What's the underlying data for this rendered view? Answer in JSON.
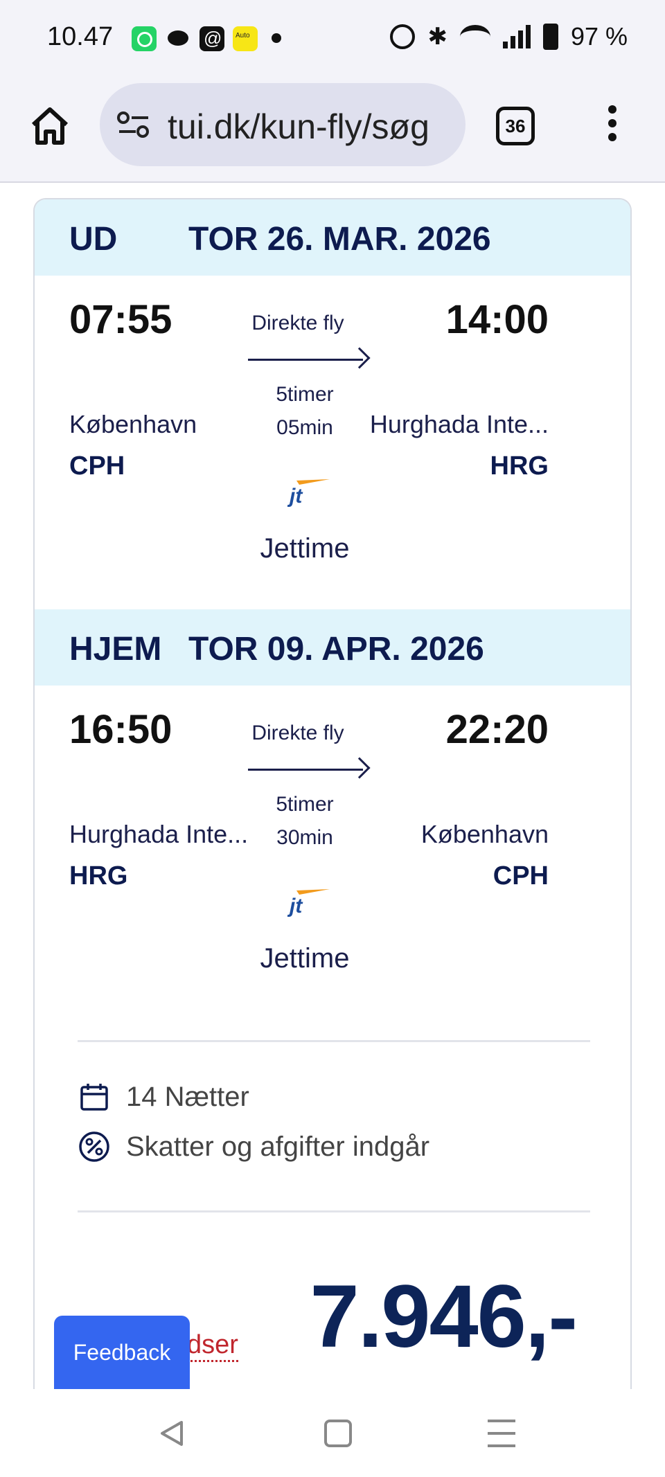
{
  "status_bar": {
    "time": "10.47",
    "notifications": [
      "whatsapp-icon",
      "messages-icon",
      "threads-icon",
      "autoscout24-icon"
    ],
    "battery": "97 %"
  },
  "browser": {
    "url": "tui.dk/kun-fly/søg",
    "tab_count": "36"
  },
  "outbound": {
    "label": "UD",
    "date": "TOR 26. MAR. 2026",
    "departure_time": "07:55",
    "arrival_time": "14:00",
    "flight_type": "Direkte fly",
    "duration_hours": "5timer",
    "duration_minutes": "05min",
    "departure_city": "København",
    "arrival_city": "Hurghada Inte...",
    "departure_code": "CPH",
    "arrival_code": "HRG",
    "airline_logo_text": "jt",
    "airline": "Jettime"
  },
  "inbound": {
    "label": "HJEM",
    "date": "TOR 09. APR. 2026",
    "departure_time": "16:50",
    "arrival_time": "22:20",
    "flight_type": "Direkte fly",
    "duration_hours": "5timer",
    "duration_minutes": "30min",
    "departure_city": "Hurghada Inte...",
    "arrival_city": "København",
    "departure_code": "HRG",
    "arrival_code": "CPH",
    "airline_logo_text": "jt",
    "airline": "Jettime"
  },
  "summary": {
    "nights": "14 Nætter",
    "taxes": "Skatter og afgifter indgår"
  },
  "price": {
    "amount": "7.946,-",
    "partial_link": "dser"
  },
  "feedback": {
    "label": "Feedback"
  },
  "colors": {
    "brand_navy": "#0d1b4f",
    "header_bg": "#e0f4fb",
    "feedback_blue": "#3466f0",
    "link_red": "#c0262d"
  }
}
